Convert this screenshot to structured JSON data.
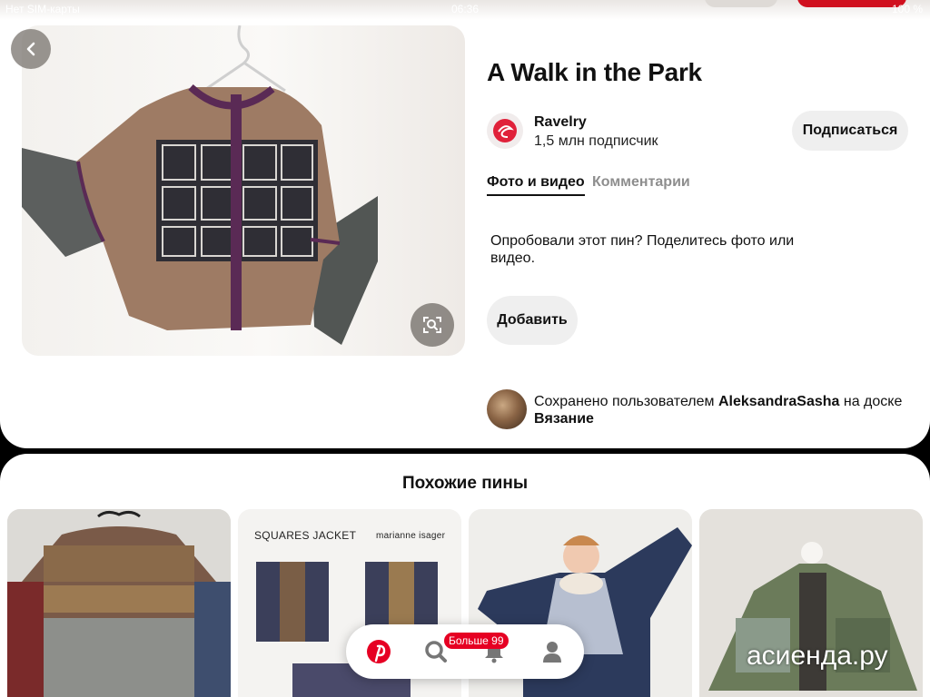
{
  "status_bar": {
    "carrier": "Нет SIM-карты",
    "time": "06:36",
    "battery": "100 %"
  },
  "pin": {
    "title": "A Walk in the Park",
    "creator": {
      "name": "Ravelry",
      "followers": "1,5 млн подписчик",
      "follow_label": "Подписаться"
    },
    "tabs": [
      {
        "label": "Фото и видео",
        "active": true
      },
      {
        "label": "Комментарии",
        "active": false
      }
    ],
    "tried_prompt": "Опробовали этот пин? Поделитесь фото или видео.",
    "add_label": "Добавить",
    "saved_by": {
      "prefix": "Сохранено пользователем",
      "user": "AleksandraSasha",
      "middle": "на доске",
      "board": "Вязание"
    }
  },
  "similar": {
    "title": "Похожие пины",
    "pins": [
      {
        "labels": []
      },
      {
        "labels": [
          "SQUARES JACKET",
          "marianne isager"
        ]
      },
      {
        "labels": []
      },
      {
        "labels": []
      }
    ]
  },
  "nav": {
    "items": [
      "pinterest-home-icon",
      "search-icon",
      "bell-icon",
      "profile-icon"
    ],
    "badge": "Больше 99"
  },
  "watermark": "асиенда.ру",
  "colors": {
    "brand_red": "#e60023",
    "button_grey": "#efefef",
    "inactive_tab": "#8e8e8e"
  }
}
